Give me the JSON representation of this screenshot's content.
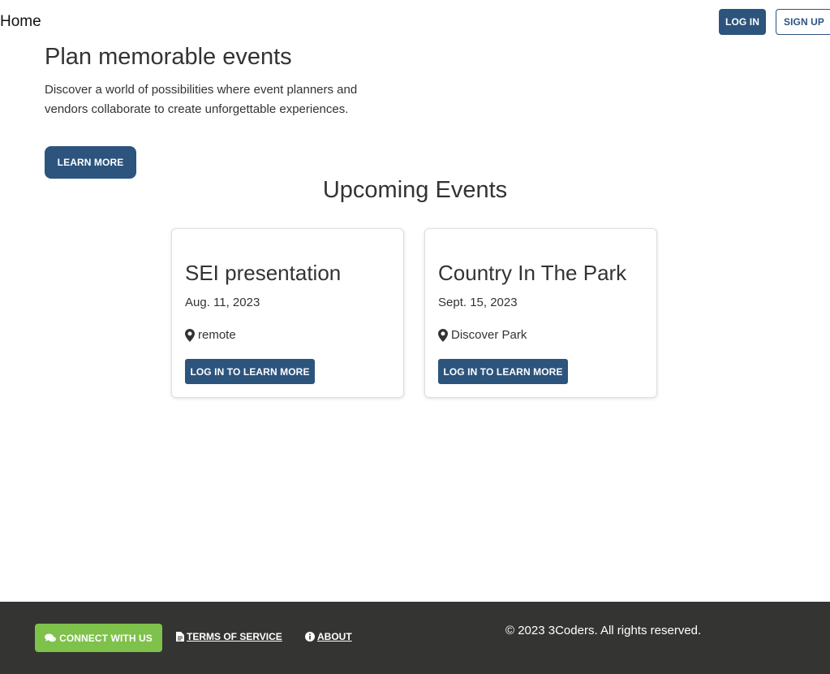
{
  "nav": {
    "home_label": "Home",
    "login_label": "LOG IN",
    "signup_label": "SIGN UP"
  },
  "hero": {
    "title": "Plan memorable events",
    "description": "Discover a world of possibilities where event planners and vendors collaborate to create unforgettable experiences.",
    "learn_more_label": "LEARN MORE"
  },
  "events": {
    "section_title": "Upcoming Events",
    "items": [
      {
        "title": "SEI presentation",
        "date": "Aug. 11, 2023",
        "location": "remote",
        "location_icon": "map-marker-icon",
        "button_label": "LOG IN TO LEARN MORE"
      },
      {
        "title": "Country In The Park",
        "date": "Sept. 15, 2023",
        "location": "Discover Park",
        "location_icon": "map-marker-icon",
        "button_label": "LOG IN TO LEARN MORE"
      }
    ]
  },
  "footer": {
    "connect_label": "CONNECT WITH US",
    "connect_icon": "comments-icon",
    "terms_label": "TERMS OF SERVICE",
    "terms_icon": "file-icon",
    "about_label": "ABOUT",
    "about_icon": "info-icon",
    "copyright": "© 2023 3Coders. All rights reserved."
  },
  "colors": {
    "primary": "#2c547d",
    "connect_green": "#7ec14b",
    "footer_bg": "#343432",
    "text": "#333333"
  }
}
